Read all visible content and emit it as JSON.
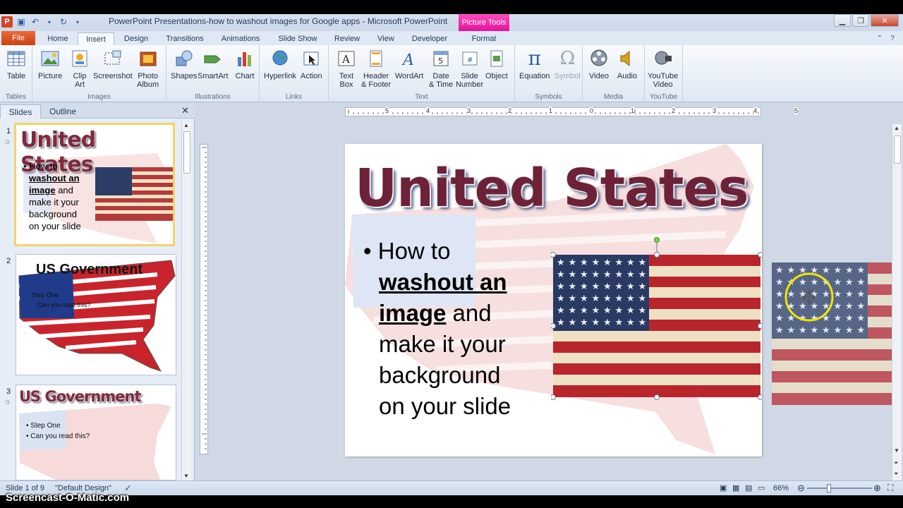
{
  "window": {
    "title": "PowerPoint Presentations-how to washout images for Google apps  -  Microsoft PowerPoint",
    "contextual_tab": "Picture Tools"
  },
  "tabs": [
    "File",
    "Home",
    "Insert",
    "Design",
    "Transitions",
    "Animations",
    "Slide Show",
    "Review",
    "View",
    "Developer",
    "Format"
  ],
  "active_tab": "Insert",
  "ribbon": {
    "groups": [
      {
        "label": "Tables",
        "buttons": [
          "Table"
        ]
      },
      {
        "label": "Images",
        "buttons": [
          "Picture",
          "Clip Art",
          "Screenshot",
          "Photo Album"
        ]
      },
      {
        "label": "Illustrations",
        "buttons": [
          "Shapes",
          "SmartArt",
          "Chart"
        ]
      },
      {
        "label": "Links",
        "buttons": [
          "Hyperlink",
          "Action"
        ]
      },
      {
        "label": "Text",
        "buttons": [
          "Text Box",
          "Header & Footer",
          "WordArt",
          "Date & Time",
          "Slide Number",
          "Object"
        ]
      },
      {
        "label": "Symbols",
        "buttons": [
          "Equation",
          "Symbol"
        ]
      },
      {
        "label": "Media",
        "buttons": [
          "Video",
          "Audio"
        ]
      },
      {
        "label": "YouTube",
        "buttons": [
          "YouTube Video"
        ]
      }
    ],
    "labels": {
      "table": "Table",
      "picture": "Picture",
      "clipart_1": "Clip",
      "clipart_2": "Art",
      "screenshot": "Screenshot",
      "photo_1": "Photo",
      "photo_2": "Album",
      "shapes": "Shapes",
      "smartart": "SmartArt",
      "chart": "Chart",
      "hyperlink": "Hyperlink",
      "action": "Action",
      "textbox_1": "Text",
      "textbox_2": "Box",
      "header_1": "Header",
      "header_2": "& Footer",
      "wordart": "WordArt",
      "date_1": "Date",
      "date_2": "& Time",
      "slidenum_1": "Slide",
      "slidenum_2": "Number",
      "object": "Object",
      "equation": "Equation",
      "symbol": "Symbol",
      "video": "Video",
      "audio": "Audio",
      "youtube_1": "YouTube",
      "youtube_2": "Video"
    }
  },
  "left_panel": {
    "tabs": [
      "Slides",
      "Outline"
    ],
    "slides": [
      {
        "number": "1",
        "title": "United States",
        "text": [
          "How to",
          "washout an",
          "image and",
          "make it your",
          "background",
          "on your slide"
        ]
      },
      {
        "number": "2",
        "title": "US Government",
        "text": [
          "Step One",
          "Can you read this?"
        ]
      },
      {
        "number": "3",
        "title": "US Government",
        "text": [
          "Step One",
          "Can you read this?"
        ]
      }
    ]
  },
  "slide": {
    "title": "United States",
    "bullet": {
      "line1": "How to",
      "bold_underline_1": "washout an",
      "bold_underline_2": "image",
      "rest": " and",
      "line4": "make it your",
      "line5": "background",
      "line6": "on your slide"
    }
  },
  "ruler": {
    "marks": [
      "5",
      "4",
      "3",
      "2",
      "1",
      "0",
      "1",
      "2",
      "3",
      "4",
      "5"
    ]
  },
  "status": {
    "slide_info": "Slide 1 of 9",
    "theme": "\"Default Design\"",
    "zoom": "66%"
  },
  "watermark": "Screencast-O-Matic.com",
  "colors": {
    "file_tab": "#c94212",
    "picture_tools": "#e6109c",
    "selection_thumb": "#f5d26a",
    "cursor_highlight": "#f2e600"
  }
}
